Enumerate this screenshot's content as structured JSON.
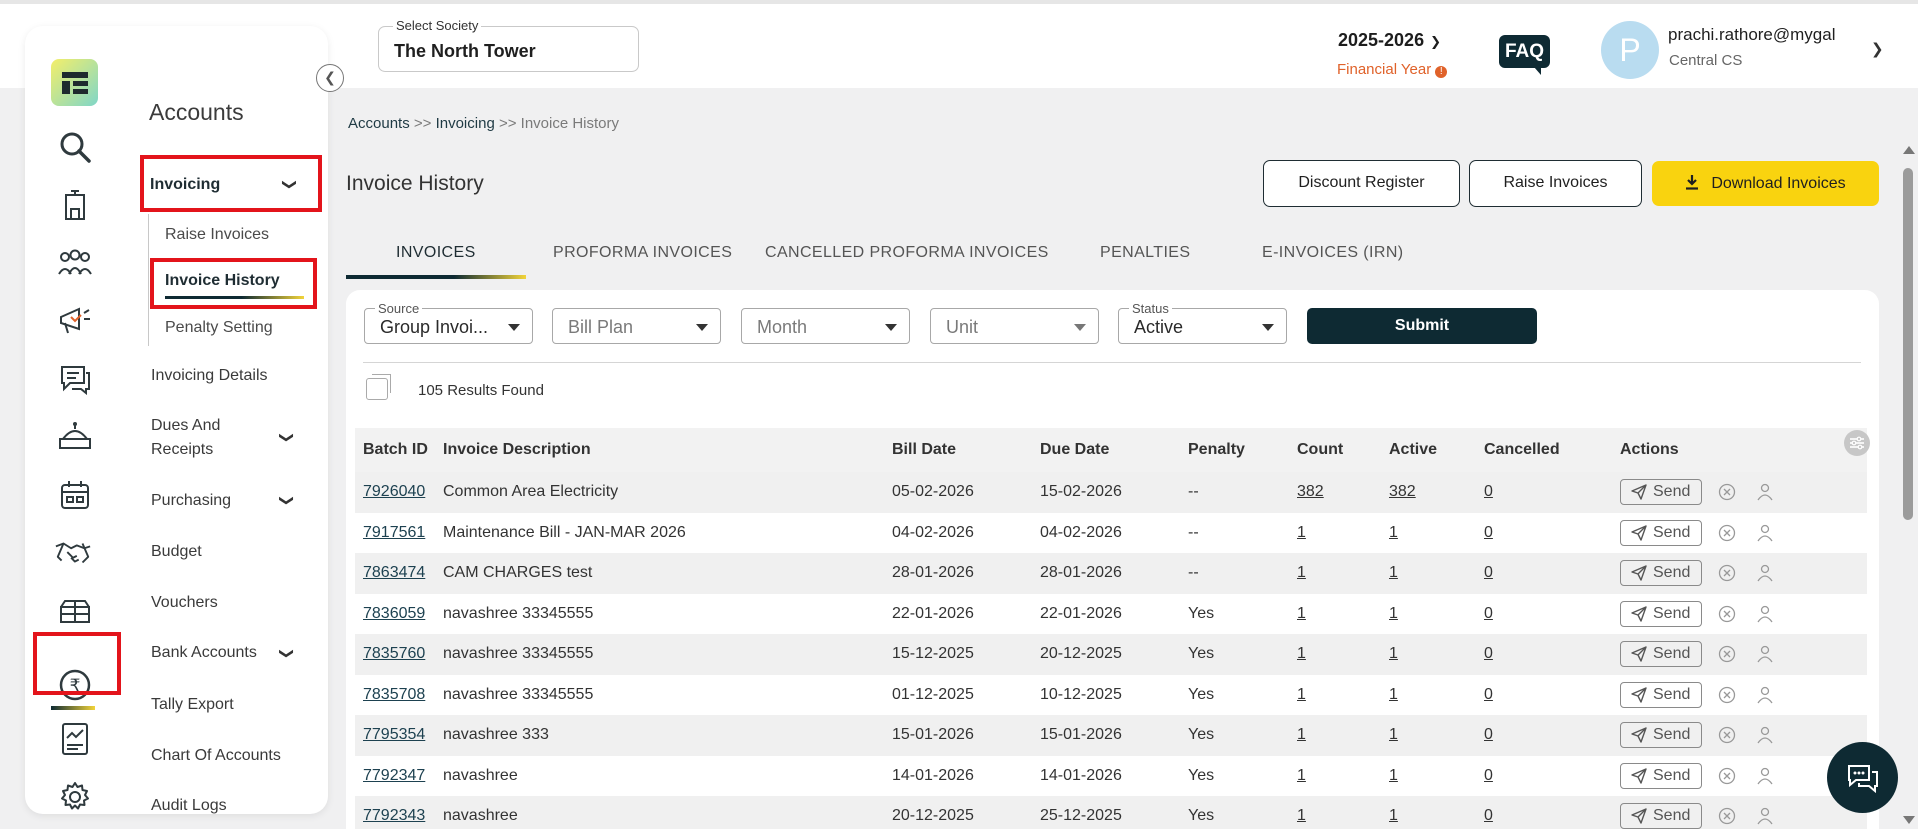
{
  "header": {
    "society_label": "Select Society",
    "society_value": "The North Tower",
    "financial_year": "2025-2026",
    "financial_year_label": "Financial Year",
    "faq_label": "FAQ",
    "avatar_initial": "P",
    "user_email": "prachi.rathore@mygal",
    "user_role": "Central CS"
  },
  "sidebar": {
    "title": "Accounts",
    "icons": [
      "search-icon",
      "building-icon",
      "people-icon",
      "megaphone-icon",
      "chat-icon",
      "helpdesk-icon",
      "calendar-icon",
      "handshake-icon",
      "amenities-icon",
      "rupee-icon",
      "reports-icon",
      "gear-icon"
    ],
    "invoicing": "Invoicing",
    "raise_invoices": "Raise Invoices",
    "invoice_history": "Invoice History",
    "penalty_setting": "Penalty Setting",
    "invoicing_details": "Invoicing Details",
    "dues_line1": "Dues And",
    "dues_line2": "Receipts",
    "purchasing": "Purchasing",
    "budget": "Budget",
    "vouchers": "Vouchers",
    "bank_accounts": "Bank Accounts",
    "tally_export": "Tally Export",
    "chart_of_accounts": "Chart Of Accounts",
    "audit_logs": "Audit Logs"
  },
  "breadcrumb": {
    "c1": "Accounts",
    "sep": ">>",
    "c2": "Invoicing",
    "c3": "Invoice History"
  },
  "page": {
    "title": "Invoice History",
    "discount_register": "Discount Register",
    "raise_invoices": "Raise Invoices",
    "download_invoices": "Download Invoices"
  },
  "tabs": [
    "INVOICES",
    "PROFORMA INVOICES",
    "CANCELLED PROFORMA INVOICES",
    "PENALTIES",
    "E-INVOICES (IRN)"
  ],
  "filters": {
    "source_label": "Source",
    "source_value": "Group Invoi...",
    "bill_plan": "Bill Plan",
    "month": "Month",
    "unit": "Unit",
    "status_label": "Status",
    "status_value": "Active",
    "submit": "Submit"
  },
  "results": {
    "count": "105",
    "text": "Results Found"
  },
  "table": {
    "headers": [
      "Batch ID",
      "Invoice Description",
      "Bill Date",
      "Due Date",
      "Penalty",
      "Count",
      "Active",
      "Cancelled",
      "Actions"
    ],
    "send_label": "Send",
    "rows": [
      [
        "7926040",
        "Common Area Electricity",
        "05-02-2026",
        "15-02-2026",
        "--",
        "382",
        "382",
        "0"
      ],
      [
        "7917561",
        "Maintenance Bill - JAN-MAR 2026",
        "04-02-2026",
        "04-02-2026",
        "--",
        "1",
        "1",
        "0"
      ],
      [
        "7863474",
        "CAM CHARGES test",
        "28-01-2026",
        "28-01-2026",
        "--",
        "1",
        "1",
        "0"
      ],
      [
        "7836059",
        "navashree 33345555",
        "22-01-2026",
        "22-01-2026",
        "Yes",
        "1",
        "1",
        "0"
      ],
      [
        "7835760",
        "navashree 33345555",
        "15-12-2025",
        "20-12-2025",
        "Yes",
        "1",
        "1",
        "0"
      ],
      [
        "7835708",
        "navashree 33345555",
        "01-12-2025",
        "10-12-2025",
        "Yes",
        "1",
        "1",
        "0"
      ],
      [
        "7795354",
        "navashree 333",
        "15-01-2026",
        "15-01-2026",
        "Yes",
        "1",
        "1",
        "0"
      ],
      [
        "7792347",
        "navashree",
        "14-01-2026",
        "14-01-2026",
        "Yes",
        "1",
        "1",
        "0"
      ],
      [
        "7792343",
        "navashree",
        "20-12-2025",
        "25-12-2025",
        "Yes",
        "1",
        "1",
        "0"
      ]
    ]
  },
  "colors": {
    "primary": "#0e2a33",
    "accent_yellow": "#f9d30f",
    "highlight_red": "#e3141b",
    "warning_orange": "#e0622a"
  }
}
